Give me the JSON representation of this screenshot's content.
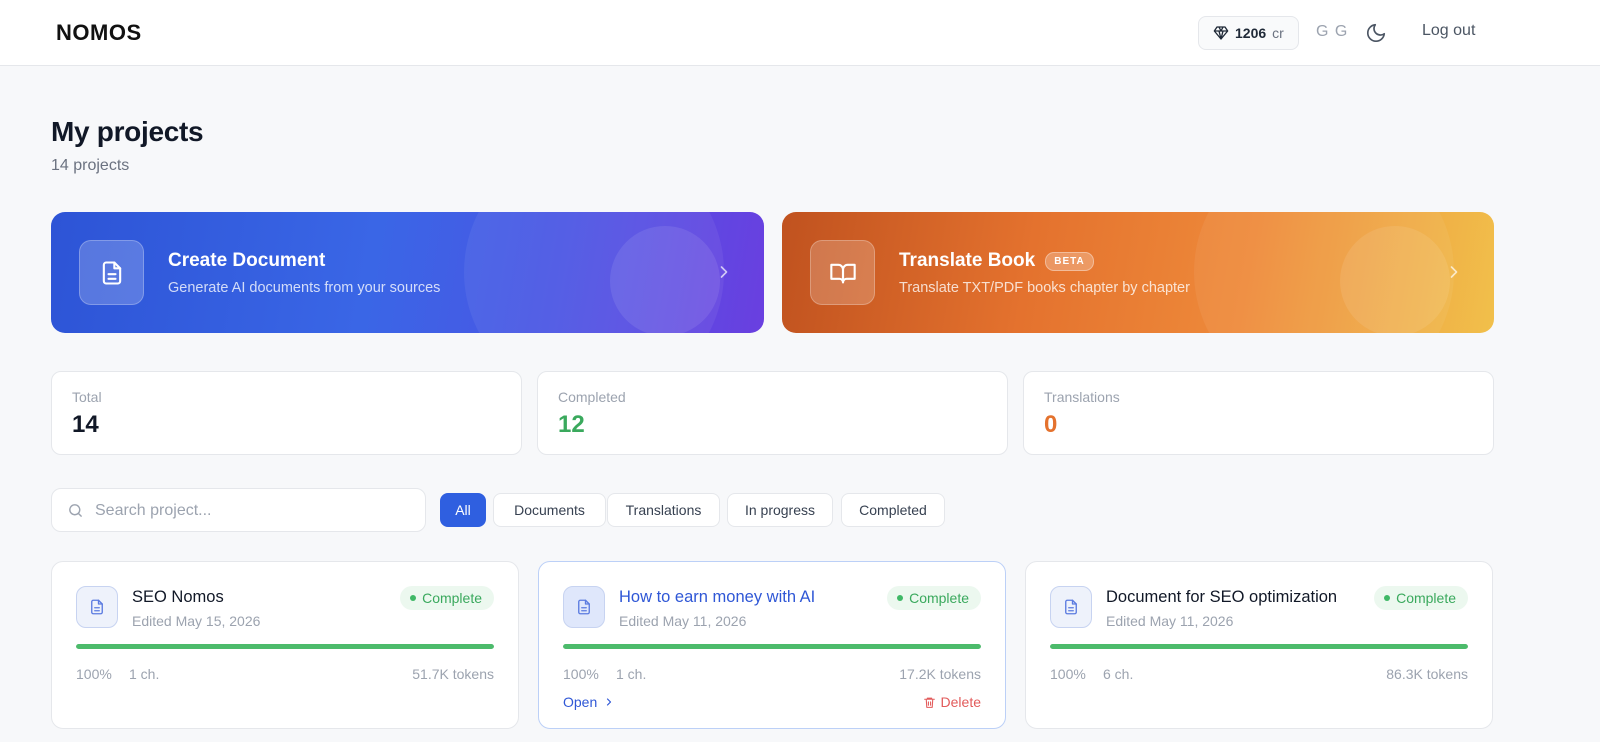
{
  "header": {
    "logo": "NOMOS",
    "credits_amount": "1206",
    "credits_unit": "cr",
    "user_initials": "G G",
    "logout_label": "Log out"
  },
  "page": {
    "title": "My projects",
    "subtitle": "14 projects"
  },
  "hero_cards": [
    {
      "title": "Create Document",
      "subtitle": "Generate AI documents from your sources",
      "icon": "document-icon"
    },
    {
      "title": "Translate Book",
      "badge": "BETA",
      "subtitle": "Translate TXT/PDF books chapter by chapter",
      "icon": "book-icon"
    }
  ],
  "stats": [
    {
      "label": "Total",
      "value": "14",
      "color": "#111827"
    },
    {
      "label": "Completed",
      "value": "12",
      "color": "#3aa95d"
    },
    {
      "label": "Translations",
      "value": "0",
      "color": "#e4722e"
    }
  ],
  "search": {
    "placeholder": "Search project..."
  },
  "filters": [
    "All",
    "Documents",
    "Translations",
    "In progress",
    "Completed"
  ],
  "active_filter": "All",
  "projects": [
    {
      "title": "SEO Nomos",
      "edited": "Edited May 15, 2026",
      "status": "Complete",
      "progress": 1.0,
      "percent": "100%",
      "chapters": "1 ch.",
      "tokens": "51.7K tokens"
    },
    {
      "title": "How to earn money with AI",
      "edited": "Edited May 11, 2026",
      "status": "Complete",
      "progress": 1.0,
      "percent": "100%",
      "chapters": "1 ch.",
      "tokens": "17.2K tokens",
      "open_label": "Open",
      "delete_label": "Delete"
    },
    {
      "title": "Document for SEO optimization",
      "edited": "Edited May 11, 2026",
      "status": "Complete",
      "progress": 1.0,
      "percent": "100%",
      "chapters": "6 ch.",
      "tokens": "86.3K tokens"
    }
  ],
  "colors": {
    "accent": "#2f5fe0",
    "success": "#3aa95d",
    "orange": "#e4722e",
    "danger": "#e25b5b"
  }
}
